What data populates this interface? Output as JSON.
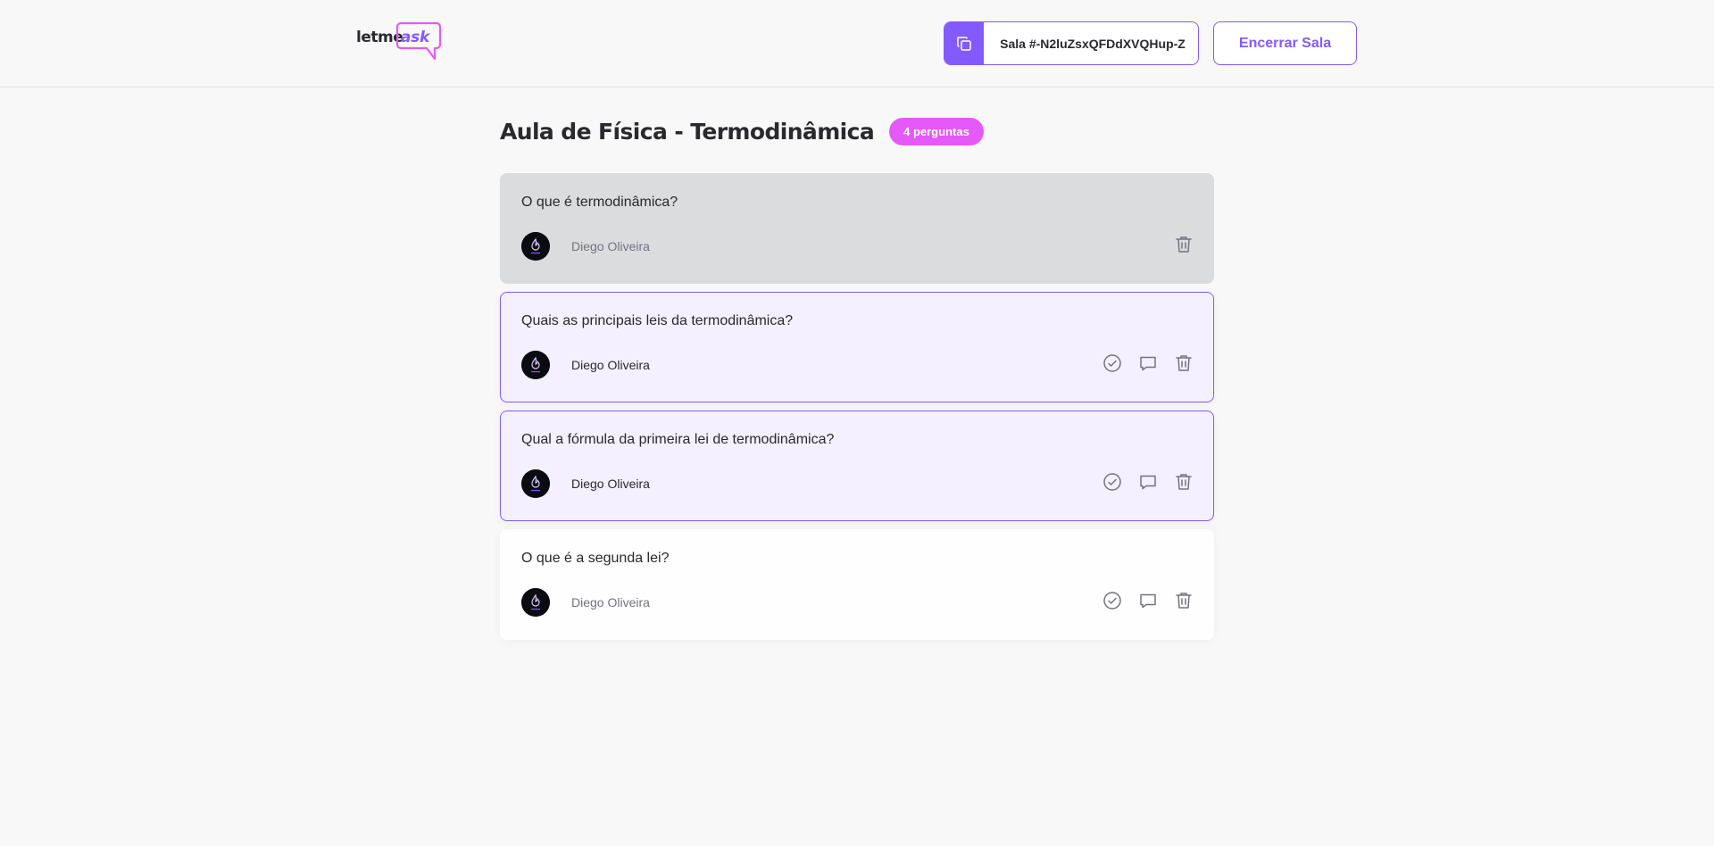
{
  "header": {
    "logo": {
      "text_left": "letme",
      "text_right": "ask"
    },
    "room_code": {
      "label": "Sala #-N2luZsxQFDdXVQHup-Z",
      "icon": "copy-icon"
    },
    "end_room_label": "Encerrar Sala"
  },
  "room": {
    "title": "Aula de Física - Termodinâmica",
    "count_badge": "4 perguntas"
  },
  "questions": [
    {
      "content": "O que é termodinâmica?",
      "author": "Diego Oliveira",
      "state": "answered",
      "actions": [
        "trash-icon"
      ]
    },
    {
      "content": "Quais as principais leis da termodinâmica?",
      "author": "Diego Oliveira",
      "state": "highlighted",
      "actions": [
        "check-circle-icon",
        "chat-icon",
        "trash-icon"
      ]
    },
    {
      "content": "Qual a fórmula da primeira lei de termodinâmica?",
      "author": "Diego Oliveira",
      "state": "highlighted",
      "actions": [
        "check-circle-icon",
        "chat-icon",
        "trash-icon"
      ]
    },
    {
      "content": "O que é a segunda lei?",
      "author": "Diego Oliveira",
      "state": "normal",
      "actions": [
        "check-circle-icon",
        "chat-icon",
        "trash-icon"
      ]
    }
  ],
  "colors": {
    "accent": "#835afd",
    "badge": "#e559f9",
    "answered_bg": "#dbdcdd",
    "highlighted_bg": "#f4f0ff",
    "page_bg": "#f8f8f8"
  }
}
